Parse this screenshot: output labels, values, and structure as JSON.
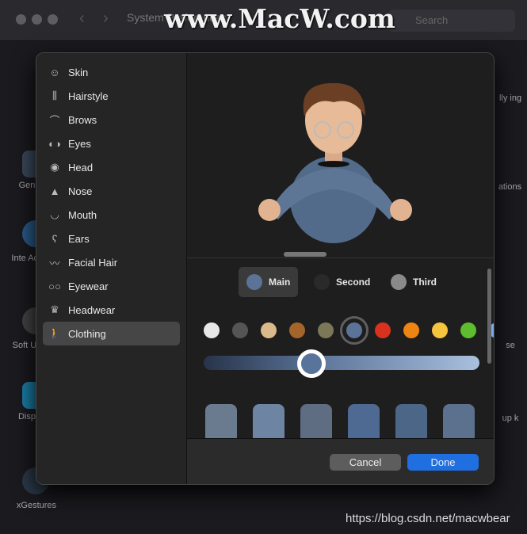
{
  "window": {
    "title": "System Preferences",
    "search_placeholder": "Search",
    "watermark": "www.MacW.com"
  },
  "background": {
    "left_labels": [
      "Gen",
      "Inte Acc",
      "Soft Up",
      "Disp",
      "xGestures"
    ],
    "right_labels": [
      "lly ing",
      "ations",
      "se",
      "up k"
    ]
  },
  "sidebar": {
    "items": [
      {
        "label": "Skin",
        "icon": "smiley-icon"
      },
      {
        "label": "Hairstyle",
        "icon": "comb-icon"
      },
      {
        "label": "Brows",
        "icon": "brow-icon"
      },
      {
        "label": "Eyes",
        "icon": "eyes-icon"
      },
      {
        "label": "Head",
        "icon": "head-icon"
      },
      {
        "label": "Nose",
        "icon": "nose-icon"
      },
      {
        "label": "Mouth",
        "icon": "mouth-icon"
      },
      {
        "label": "Ears",
        "icon": "ear-icon"
      },
      {
        "label": "Facial Hair",
        "icon": "mustache-icon"
      },
      {
        "label": "Eyewear",
        "icon": "glasses-icon"
      },
      {
        "label": "Headwear",
        "icon": "crown-icon"
      },
      {
        "label": "Clothing",
        "icon": "figure-icon",
        "selected": true
      }
    ]
  },
  "color_tabs": [
    {
      "label": "Main",
      "color": "#5a7397",
      "selected": true
    },
    {
      "label": "Second",
      "color": "#2a2a2a"
    },
    {
      "label": "Third",
      "color": "#8a8a8a"
    }
  ],
  "swatches": [
    "#e8e8e8",
    "#555555",
    "#dcb98a",
    "#a5642a",
    "#7b7757",
    "#5a7397",
    "#d8321e",
    "#ee8512",
    "#f6c53e",
    "#5ebd2e",
    "#7aa6f2"
  ],
  "selected_swatch": 5,
  "slider": {
    "value": 0.39
  },
  "buttons": {
    "cancel": "Cancel",
    "done": "Done"
  },
  "footer_watermark": "https://blog.csdn.net/macwbear"
}
